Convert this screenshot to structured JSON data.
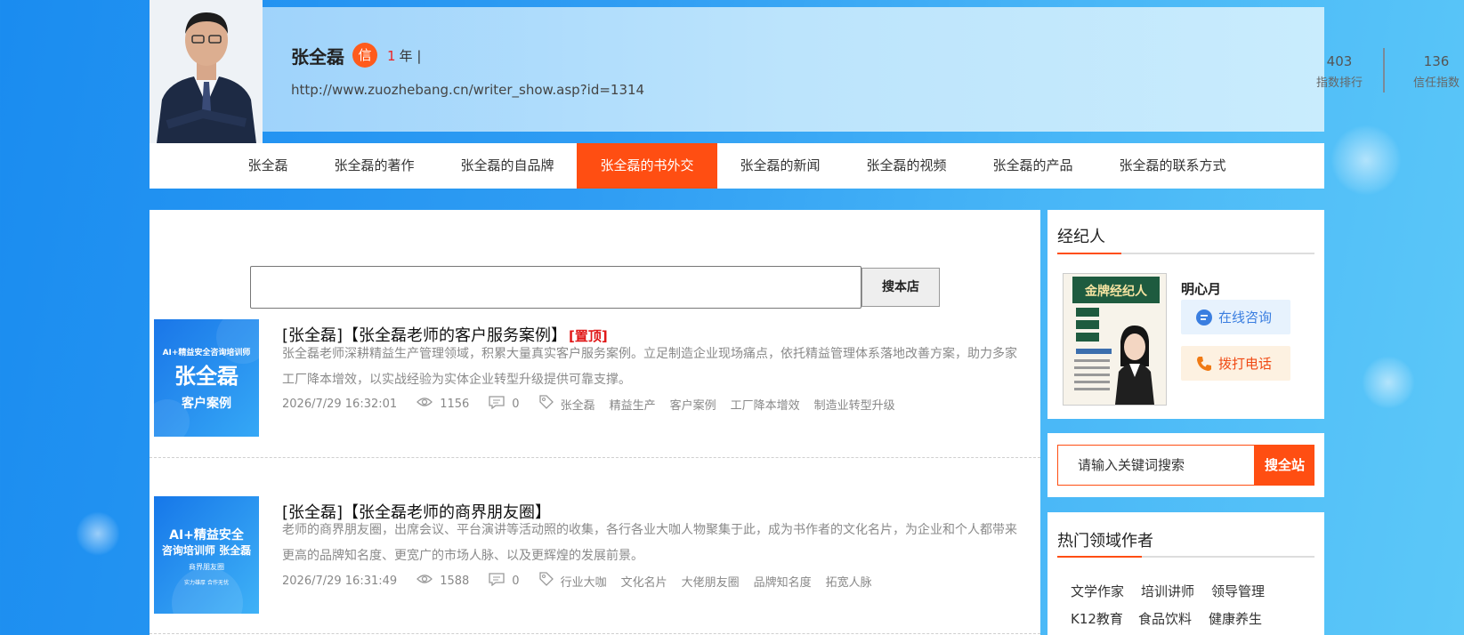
{
  "writer": {
    "name": "张全磊",
    "badge": "信",
    "years_num": "1",
    "years_suffix": "年 |",
    "url": "http://www.zuozhebang.cn/writer_show.asp?id=1314",
    "stats": [
      {
        "value": "403",
        "label": "指数排行"
      },
      {
        "value": "136",
        "label": "信任指数"
      }
    ]
  },
  "nav": {
    "items": [
      "张全磊",
      "张全磊的著作",
      "张全磊的自品牌",
      "张全磊的书外交",
      "张全磊的新闻",
      "张全磊的视频",
      "张全磊的产品",
      "张全磊的联系方式"
    ],
    "active_index": 3
  },
  "search": {
    "value": "",
    "button": "搜本店"
  },
  "articles": [
    {
      "title": "[张全磊]【张全磊老师的客户服务案例】",
      "pin": "[置顶]",
      "desc": "张全磊老师深耕精益生产管理领域，积累大量真实客户服务案例。立足制造企业现场痛点，依托精益管理体系落地改善方案，助力多家工厂降本增效，以实战经验为实体企业转型升级提供可靠支撑。",
      "date": "2026/7/29 16:32:01",
      "views": "1156",
      "comments": "0",
      "tags": [
        "张全磊",
        "精益生产",
        "客户案例",
        "工厂降本增效",
        "制造业转型升级"
      ],
      "thumb": {
        "line1": "AI+精益安全咨询培训师",
        "line2": "张全磊",
        "line3": "客户案例"
      }
    },
    {
      "title": "[张全磊]【张全磊老师的商界朋友圈】",
      "pin": "",
      "desc": "老师的商界朋友圈，出席会议、平台演讲等活动照的收集，各行各业大咖人物聚集于此，成为书作者的文化名片，为企业和个人都带来更高的品牌知名度、更宽广的市场人脉、以及更辉煌的发展前景。",
      "date": "2026/7/29 16:31:49",
      "views": "1588",
      "comments": "0",
      "tags": [
        "行业大咖",
        "文化名片",
        "大佬朋友圈",
        "品牌知名度",
        "拓宽人脉"
      ],
      "thumb": {
        "line1": "AI+精益安全",
        "line2": "咨询培训师 张全磊",
        "line3": "商界朋友圈",
        "line4": "实力雄厚 合作无忧"
      }
    }
  ],
  "agent": {
    "section_title": "经纪人",
    "name": "明心月",
    "consult": "在线咨询",
    "call": "拨打电话",
    "poster_title": "金牌经纪人"
  },
  "site_search": {
    "placeholder": "请输入关键词搜索",
    "button": "搜全站"
  },
  "hot": {
    "title": "热门领域作者",
    "tags": [
      "文学作家",
      "培训讲师",
      "领导管理",
      "K12教育",
      "食品饮料",
      "健康养生"
    ]
  },
  "colors": {
    "accent": "#ff4e12",
    "pin": "#e01818",
    "page_bg": "#2f9df3"
  }
}
